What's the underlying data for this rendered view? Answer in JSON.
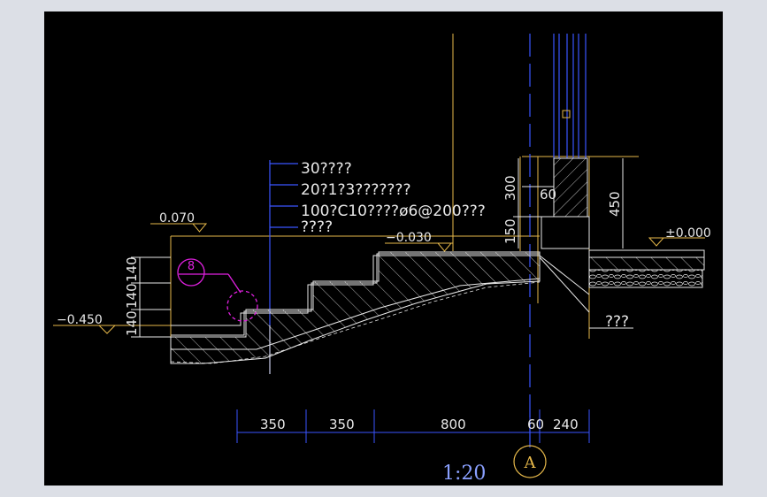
{
  "colors": {
    "background": "#000000",
    "frame": "#dcdfe6",
    "yellow": "#e6b84a",
    "blue": "#3a55ff",
    "magenta": "#e020e0",
    "white": "#e8e8e8",
    "cyan": "#38c0d8"
  },
  "notes": {
    "line1": "30????",
    "line2": "20?1?3???????",
    "line3": "100?C10????ø6@200???",
    "line4": "????"
  },
  "levels": {
    "left_top": "0.070",
    "left_bottom": "−0.450",
    "step_top": "−0.030",
    "ground": "±0.000"
  },
  "dims_vertical": {
    "riser1": "140",
    "riser2": "140",
    "riser3": "140",
    "wall_300": "300",
    "wall_150": "150",
    "wall_450": "450"
  },
  "dims_horizontal": {
    "d1": "350",
    "d2": "350",
    "d3": "800",
    "d4": "60",
    "d5": "240"
  },
  "wall_mark": "60",
  "leader_right": "???",
  "detail_ref": "8",
  "scale": "1:20",
  "axis_label": "A"
}
